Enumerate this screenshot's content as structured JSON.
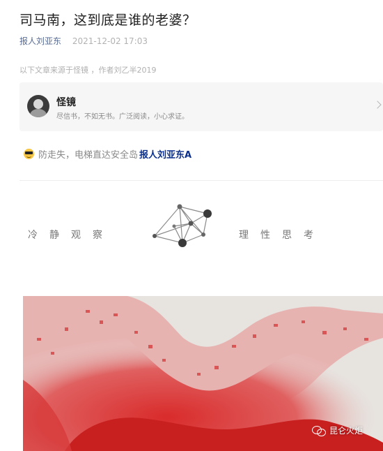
{
  "article": {
    "title": "司马南，这到底是谁的老婆？",
    "author": "报人刘亚东",
    "date": "2021-12-02 17:03",
    "source_note": "以下文章来源于怪镜 ，作者刘乙半2019"
  },
  "source_card": {
    "name": "怪镜",
    "description": "尽信书，不如无书。广泛阅读，小心求证。",
    "avatar_icon": "profile-avatar",
    "chevron_icon": "chevron-right-icon"
  },
  "promo": {
    "emoji_icon": "sunglasses-emoji-icon",
    "text": "防走失，电梯直达安全岛",
    "link": "报人刘亚东A"
  },
  "banner": {
    "left_motto": "冷静观察",
    "right_motto": "理性思考",
    "icon": "network-nodes-icon"
  },
  "image": {
    "watermark": "昆仑火炬",
    "watermark_icon": "wechat-icon",
    "accent_color": "#d63a3a"
  }
}
